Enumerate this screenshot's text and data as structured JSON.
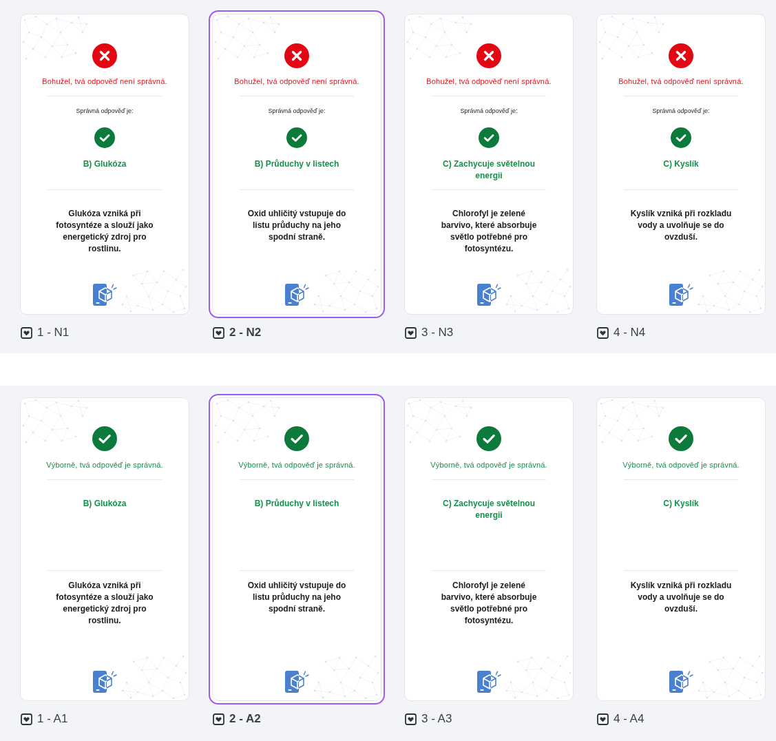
{
  "sections": [
    {
      "slides": [
        {
          "label": "1 - N1",
          "selected": false,
          "kind": "incorrect",
          "message": "Bohužel, tvá odpověď není správná.",
          "correct_label": "Správná odpověď je:",
          "answer": "B) Glukóza",
          "explanation": "Glukóza vzniká při fotosyntéze a slouží jako energetický zdroj pro rostlinu."
        },
        {
          "label": "2 - N2",
          "selected": true,
          "kind": "incorrect",
          "message": "Bohužel, tvá odpověď není správná.",
          "correct_label": "Správná odpověď je:",
          "answer": "B) Průduchy v listech",
          "explanation": "Oxid uhličitý vstupuje do listu průduchy na jeho spodní straně."
        },
        {
          "label": "3 - N3",
          "selected": false,
          "kind": "incorrect",
          "message": "Bohužel, tvá odpověď není správná.",
          "correct_label": "Správná odpověď je:",
          "answer": "C) Zachycuje světelnou energii",
          "explanation": "Chlorofyl je zelené barvivo, které absorbuje světlo potřebné pro fotosyntézu."
        },
        {
          "label": "4 - N4",
          "selected": false,
          "kind": "incorrect",
          "message": "Bohužel, tvá odpověď není správná.",
          "correct_label": "Správná odpověď je:",
          "answer": "C) Kyslík",
          "explanation": "Kyslík vzniká při rozkladu vody a uvolňuje se do ovzduší."
        }
      ]
    },
    {
      "slides": [
        {
          "label": "1 - A1",
          "selected": false,
          "kind": "correct",
          "message": "Výborně, tvá odpověď je správná.",
          "answer": "B) Glukóza",
          "explanation": "Glukóza vzniká při fotosyntéze a slouží jako energetický zdroj pro rostlinu."
        },
        {
          "label": "2 - A2",
          "selected": true,
          "kind": "correct",
          "message": "Výborně, tvá odpověď je správná.",
          "answer": "B) Průduchy v listech",
          "explanation": "Oxid uhličitý vstupuje do listu průduchy na jeho spodní straně."
        },
        {
          "label": "3 - A3",
          "selected": false,
          "kind": "correct",
          "message": "Výborně, tvá odpověď je správná.",
          "answer": "C) Zachycuje světelnou energii",
          "explanation": "Chlorofyl je zelené barvivo, které absorbuje světlo potřebné pro fotosyntézu."
        },
        {
          "label": "4 - A4",
          "selected": false,
          "kind": "correct",
          "message": "Výborně, tvá odpověď je správná.",
          "answer": "C) Kyslík",
          "explanation": "Kyslík vzniká při rozkladu vody a uvolňuje se do ovzduší."
        }
      ]
    }
  ]
}
